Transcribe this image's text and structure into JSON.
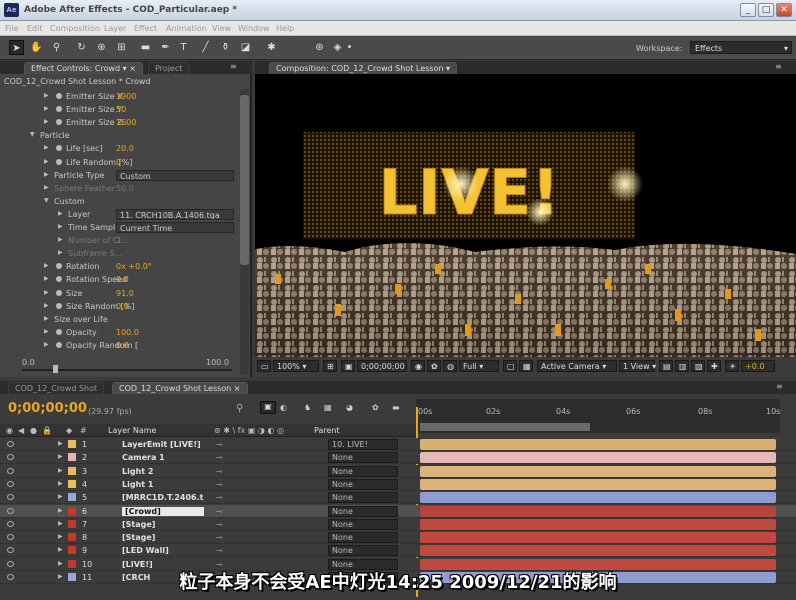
{
  "window": {
    "title": "Adobe After Effects - COD_Particular.aep *",
    "app_icon": "Ae",
    "min": "_",
    "max": "□",
    "close": "✕"
  },
  "menu": [
    "File",
    "Edit",
    "Composition",
    "Layer",
    "Effect",
    "Animation",
    "View",
    "Window",
    "Help"
  ],
  "workspace": {
    "label": "Workspace:",
    "value": "Effects"
  },
  "effect_controls": {
    "tab_label": "Effect Controls: Crowd",
    "project_tab": "Project",
    "header": "COD_12_Crowd Shot Lesson * Crowd",
    "rows": [
      {
        "name": "Emitter Size X",
        "value": "1900",
        "indent": 1,
        "kind": "value"
      },
      {
        "name": "Emitter Size Y",
        "value": "50",
        "indent": 1,
        "kind": "value"
      },
      {
        "name": "Emitter Size Z",
        "value": "1600",
        "indent": 1,
        "kind": "value"
      },
      {
        "name": "Particle",
        "value": "",
        "indent": 0,
        "kind": "group"
      },
      {
        "name": "Life [sec]",
        "value": "20.0",
        "indent": 1,
        "kind": "value"
      },
      {
        "name": "Life Random [%]",
        "value": "0",
        "indent": 1,
        "kind": "value"
      },
      {
        "name": "Particle Type",
        "value": "Custom",
        "indent": 1,
        "kind": "dropdown"
      },
      {
        "name": "Sphere Feather",
        "value": "50.0",
        "indent": 1,
        "kind": "dim"
      },
      {
        "name": "Custom",
        "value": "",
        "indent": 1,
        "kind": "group"
      },
      {
        "name": "Layer",
        "value": "11. CRCH10B.A.1406.tga",
        "indent": 2,
        "kind": "dropdown"
      },
      {
        "name": "Time Sampling",
        "value": "Current Time",
        "indent": 2,
        "kind": "dropdown"
      },
      {
        "name": "Number of Cl...",
        "value": "2",
        "indent": 2,
        "kind": "dim"
      },
      {
        "name": "Subframe S...",
        "value": "",
        "indent": 2,
        "kind": "dim"
      },
      {
        "name": "Rotation",
        "value": "0x +0.0°",
        "indent": 1,
        "kind": "value"
      },
      {
        "name": "Rotation Speed",
        "value": "0.0",
        "indent": 1,
        "kind": "value"
      },
      {
        "name": "Size",
        "value": "91.0",
        "indent": 1,
        "kind": "value"
      },
      {
        "name": "Size Random [%]",
        "value": "0.0",
        "indent": 1,
        "kind": "value"
      },
      {
        "name": "Size over Life",
        "value": "",
        "indent": 1,
        "kind": "plain"
      },
      {
        "name": "Opacity",
        "value": "100.0",
        "indent": 1,
        "kind": "value"
      },
      {
        "name": "Opacity Random [",
        "value": "0.0",
        "indent": 1,
        "kind": "value"
      }
    ],
    "slider": {
      "min": "0.0",
      "max": "100.0"
    }
  },
  "composition": {
    "tab_label": "Composition: COD_12_Crowd Shot Lesson",
    "screen_text": "LIVE!",
    "zoom": "100%",
    "timecode": "0;00;00;00",
    "resolution": "Full",
    "camera": "Active Camera",
    "views": "1 View",
    "exposure": "+0.0"
  },
  "timeline": {
    "tabs": [
      "COD_12_Crowd Shot",
      "COD_12_Crowd Shot Lesson"
    ],
    "time": "0;00;00;00",
    "fps": "(29.97 fps)",
    "col_layer_name": "Layer Name",
    "col_parent": "Parent",
    "ruler": [
      "00s",
      "02s",
      "04s",
      "06s",
      "08s",
      "10s"
    ],
    "layers": [
      {
        "num": "1",
        "name": "LayerEmit [LIVE!]",
        "parent": "10. LIVE!",
        "label_color": "#e6c15a",
        "bar_color": "#d9b070"
      },
      {
        "num": "2",
        "name": "Camera 1",
        "parent": "None",
        "label_color": "#e8b3b3",
        "bar_color": "#e8b8b8"
      },
      {
        "num": "3",
        "name": "Light 2",
        "parent": "None",
        "label_color": "#e6c15a",
        "bar_color": "#dcb47a"
      },
      {
        "num": "4",
        "name": "Light 1",
        "parent": "None",
        "label_color": "#e6c15a",
        "bar_color": "#dcb47a"
      },
      {
        "num": "5",
        "name": "[MRRC1D.T.2406.t",
        "parent": "None",
        "label_color": "#9aa6d8",
        "bar_color": "#8e9cd0"
      },
      {
        "num": "6",
        "name": "[Crowd]",
        "parent": "None",
        "label_color": "#c0392b",
        "bar_color": "#b8443a"
      },
      {
        "num": "7",
        "name": "[Stage]",
        "parent": "None",
        "label_color": "#c0392b",
        "bar_color": "#c0483c"
      },
      {
        "num": "8",
        "name": "[Stage]",
        "parent": "None",
        "label_color": "#c0392b",
        "bar_color": "#c0483c"
      },
      {
        "num": "9",
        "name": "[LED Wall]",
        "parent": "None",
        "label_color": "#c0392b",
        "bar_color": "#c0483c"
      },
      {
        "num": "10",
        "name": "[LIVE!]",
        "parent": "None",
        "label_color": "#c0392b",
        "bar_color": "#c0483c"
      },
      {
        "num": "11",
        "name": "[CRCH",
        "parent": "None",
        "label_color": "#9aa6d8",
        "bar_color": "#8e9cd0"
      }
    ]
  },
  "subtitle": "粒子本身不会受AE中灯光14:25 2009/12/21的影响"
}
